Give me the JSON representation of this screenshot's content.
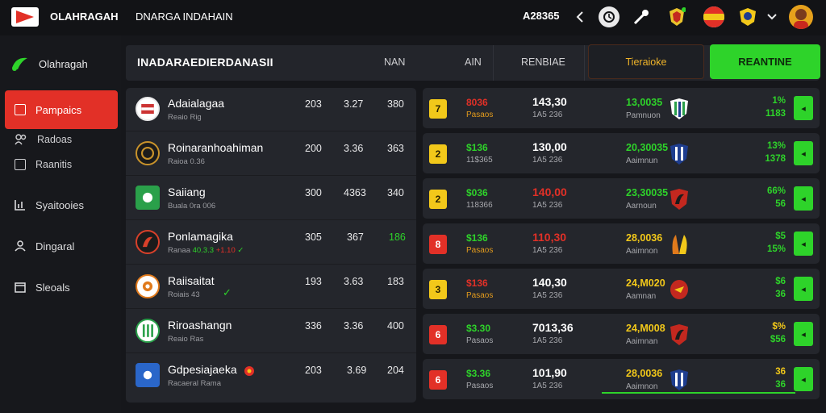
{
  "topbar": {
    "brand": "OLAHRAGAH",
    "page_heading": "DNARGA INDAHAIN",
    "balance": "A28365",
    "back_icon": "chevron-left-icon",
    "clock_icon": "clock-icon",
    "tool_icon": "wrench-icon",
    "badges": [
      "team-badge-icon",
      "flag-icon",
      "crest-icon"
    ],
    "dropdown_icon": "chevron-down-icon",
    "avatar_icon": "avatar-icon"
  },
  "sidebar": {
    "brand": "Olahragah",
    "items": [
      {
        "label": "Pampaics",
        "icon": "folder-icon",
        "active": true
      },
      {
        "label": "Radoas",
        "icon": "group-icon"
      },
      {
        "label": "Raanitis",
        "icon": "list-icon"
      },
      {
        "label": "Syaitooies",
        "icon": "chart-icon"
      },
      {
        "label": "Dingaral",
        "icon": "user-icon"
      },
      {
        "label": "Sleoals",
        "icon": "calendar-icon"
      }
    ]
  },
  "header": {
    "title": "INADARAEDIERDANASII",
    "col1": "NAN",
    "col2": "AIN",
    "col3": "RENBIAE",
    "btn_secondary": "Tieraioke",
    "btn_primary": "REANTINE"
  },
  "teams": [
    {
      "name": "Adaialagaa",
      "sub": "Reaio Rig",
      "v1": "203",
      "v2": "3.27",
      "v3": "380",
      "crest_color": "#c33"
    },
    {
      "name": "Roinaranhoahiman",
      "sub": "Raioa 0.36",
      "v1": "200",
      "v2": "3.36",
      "v3": "363",
      "crest_color": "#c9932b"
    },
    {
      "name": "Saiiang",
      "sub": "Buala 0ra 006",
      "v1": "300",
      "v2": "4363",
      "v3": "340",
      "crest_color": "#2aa04a"
    },
    {
      "name": "Ponlamagika",
      "sub": "Ranaa",
      "sub_hl": "40.3.3",
      "sub_hr": "+1.10",
      "v1": "305",
      "v2": "367",
      "v3": "186",
      "v3_green": true,
      "tick": true,
      "crest_color": "#d9402a"
    },
    {
      "name": "Raiisaitat",
      "sub": "Roiais 43",
      "v1": "193",
      "v2": "3.63",
      "v3": "183",
      "tick_sub": true,
      "crest_color": "#e07a1c"
    },
    {
      "name": "Riroashangn",
      "sub": "Reaio Ras",
      "v1": "336",
      "v2": "3.36",
      "v3": "400",
      "crest_color": "#2aa04a"
    },
    {
      "name": "Gdpesiajaeka",
      "sub": "Racaeral Rama",
      "v1": "203",
      "v2": "3.69",
      "v3": "204",
      "crest_color": "#2a66c9",
      "dot": true
    }
  ],
  "matches": [
    {
      "rank": "7",
      "rank_color": "y",
      "odd_a": "8036",
      "odd_a_color": "red",
      "odd_a_sub": "Pasaos",
      "score": "143,30",
      "score_color": "white",
      "score_sub": "1A5 236",
      "odd_b": "13,0035",
      "odd_b_sub": "Pamnuon",
      "shield": "green-stripe",
      "pct": "1%",
      "pct_sub": "1183",
      "pct_color": "green"
    },
    {
      "rank": "2",
      "rank_color": "y",
      "odd_a": "$136",
      "odd_a_color": "green",
      "odd_a_sub": "11$365",
      "score": "130,00",
      "score_color": "white",
      "score_sub": "1A5 236",
      "odd_b": "20,30035",
      "odd_b_sub": "Aaimnun",
      "shield": "blue-stripe",
      "pct": "13%",
      "pct_sub": "1378",
      "pct_color": "green"
    },
    {
      "rank": "2",
      "rank_color": "y",
      "odd_a": "$036",
      "odd_a_color": "green",
      "odd_a_sub": "118366",
      "score": "140,00",
      "score_color": "red",
      "score_sub": "1A5 236",
      "odd_b": "23,30035",
      "odd_b_sub": "Aarnoun",
      "shield": "red-dragon",
      "pct": "66%",
      "pct_sub": "56",
      "pct_color": "green"
    },
    {
      "rank": "8",
      "rank_color": "r",
      "odd_a": "$136",
      "odd_a_color": "green",
      "odd_a_sub": "Pasaos",
      "score": "110,30",
      "score_color": "red",
      "score_sub": "1A5 236",
      "odd_b": "28,0036",
      "odd_b_sub": "Aaimnon",
      "shield": "orange-horns",
      "pct": "$5",
      "pct_sub": "15%",
      "pct_color": "green"
    },
    {
      "rank": "3",
      "rank_color": "y",
      "odd_a": "$136",
      "odd_a_color": "red",
      "odd_a_sub": "Pasaos",
      "score": "140,30",
      "score_color": "white",
      "score_sub": "1A5 236",
      "odd_b": "24,M020",
      "odd_b_sub": "Aamnan",
      "shield": "red-eagle",
      "pct": "$6",
      "pct_sub": "36",
      "pct_color": "green"
    },
    {
      "rank": "6",
      "rank_color": "r",
      "odd_a": "$3.30",
      "odd_a_color": "green",
      "odd_a_sub": "Pasaos",
      "score": "7013,36",
      "score_color": "white",
      "score_sub": "1A5 236",
      "odd_b": "24,M008",
      "odd_b_sub": "Aaimnan",
      "shield": "red-dragon",
      "pct": "$%",
      "pct_sub": "$56",
      "pct_color": "green"
    },
    {
      "rank": "6",
      "rank_color": "r",
      "odd_a": "$3.36",
      "odd_a_color": "green",
      "odd_a_sub": "Pasaos",
      "score": "101,90",
      "score_color": "white",
      "score_sub": "1A5 236",
      "odd_b": "28,0036",
      "odd_b_sub": "Aaimnon",
      "shield": "blue-stripe",
      "pct": "36",
      "pct_sub": "36",
      "pct_color": "green"
    }
  ]
}
